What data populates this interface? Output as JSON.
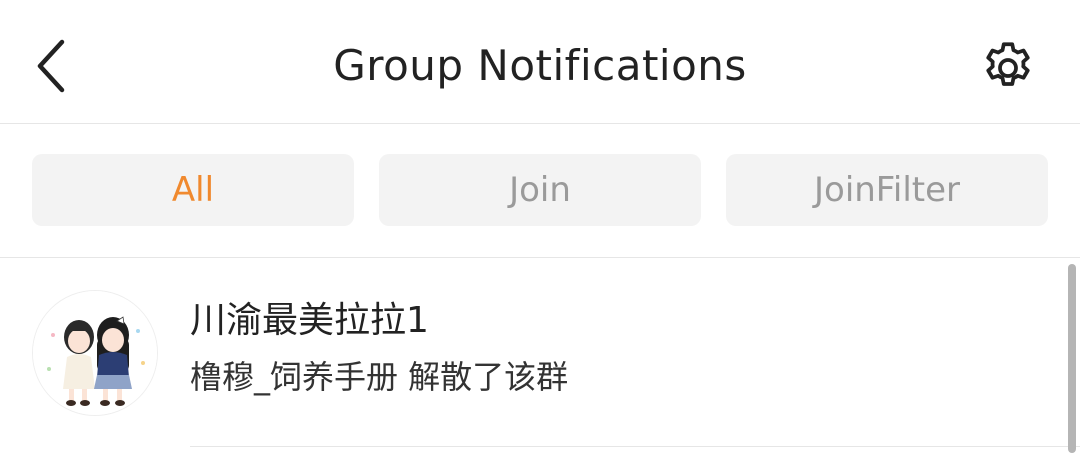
{
  "header": {
    "title": "Group Notifications",
    "back_icon": "chevron-left-icon",
    "settings_icon": "gear-icon"
  },
  "tabs": [
    {
      "label": "All",
      "active": true
    },
    {
      "label": "Join",
      "active": false
    },
    {
      "label": "JoinFilter",
      "active": false
    }
  ],
  "notifications": [
    {
      "group_name": "川渝最美拉拉1",
      "message": "橹穆_饲养手册 解散了该群",
      "avatar_icon": "group-avatar-illustration"
    }
  ],
  "colors": {
    "accent": "#f0892e",
    "tab_bg": "#f3f3f3",
    "tab_inactive_text": "#9a9a9a",
    "divider": "#e6e6e6"
  }
}
